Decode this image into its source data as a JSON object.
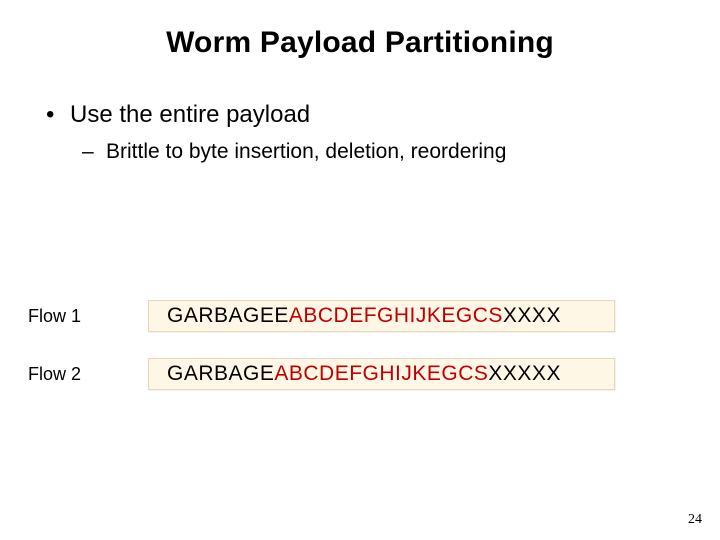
{
  "title": "Worm Payload Partitioning",
  "bullets": {
    "l1": "Use the entire payload",
    "l2": "Brittle to byte insertion, deletion, reordering"
  },
  "flows": [
    {
      "label": "Flow 1",
      "garbage": "GARBAGEE",
      "core": "ABCDEFGHIJKEGCS",
      "tail": "XXXX"
    },
    {
      "label": "Flow 2",
      "garbage": "GARBAGE",
      "core": "ABCDEFGHIJKEGCS",
      "tail": "XXXXX"
    }
  ],
  "page_number": "24"
}
